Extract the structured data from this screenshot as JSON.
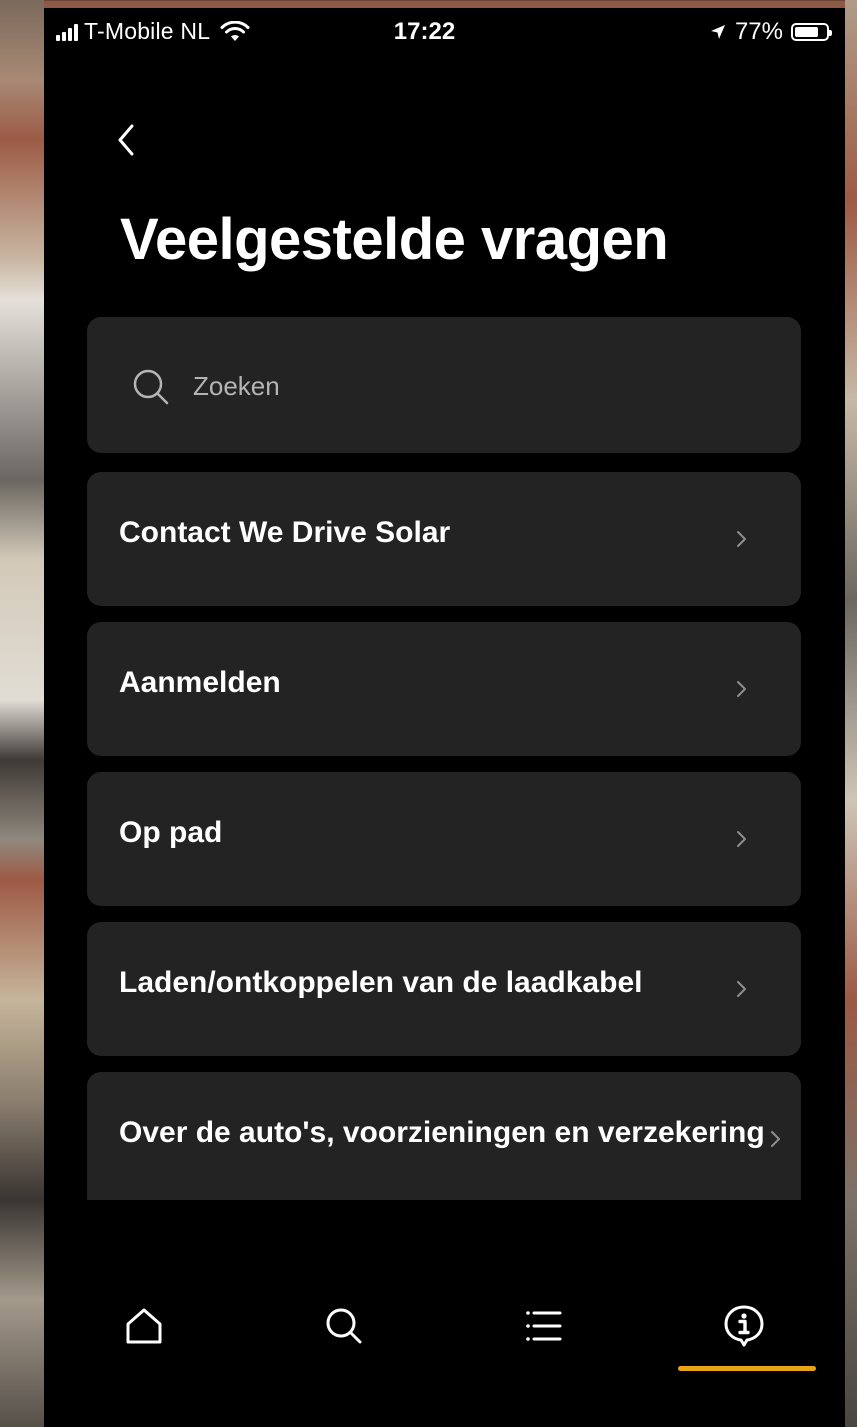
{
  "status_bar": {
    "carrier": "T-Mobile NL",
    "time": "17:22",
    "battery_percent": "77%",
    "battery_level": 0.77
  },
  "header": {
    "back_icon": "chevron-left-icon",
    "title": "Veelgestelde vragen"
  },
  "search": {
    "placeholder": "Zoeken",
    "value": "",
    "icon": "search-icon"
  },
  "faq_items": [
    {
      "label": "Contact We Drive Solar"
    },
    {
      "label": "Aanmelden"
    },
    {
      "label": "Op pad"
    },
    {
      "label": "Laden/ontkoppelen van de laadkabel"
    },
    {
      "label": "Over de auto's, voorzieningen en verzekering"
    }
  ],
  "bottom_nav": {
    "items": [
      {
        "icon": "home-icon",
        "active": false
      },
      {
        "icon": "search-icon",
        "active": false
      },
      {
        "icon": "list-icon",
        "active": false
      },
      {
        "icon": "info-icon",
        "active": true
      }
    ]
  },
  "colors": {
    "background": "#000000",
    "card": "#232323",
    "text": "#ffffff",
    "placeholder": "#b4b4b4",
    "chevron": "#8e8e8e",
    "accent": "#e8a317"
  }
}
